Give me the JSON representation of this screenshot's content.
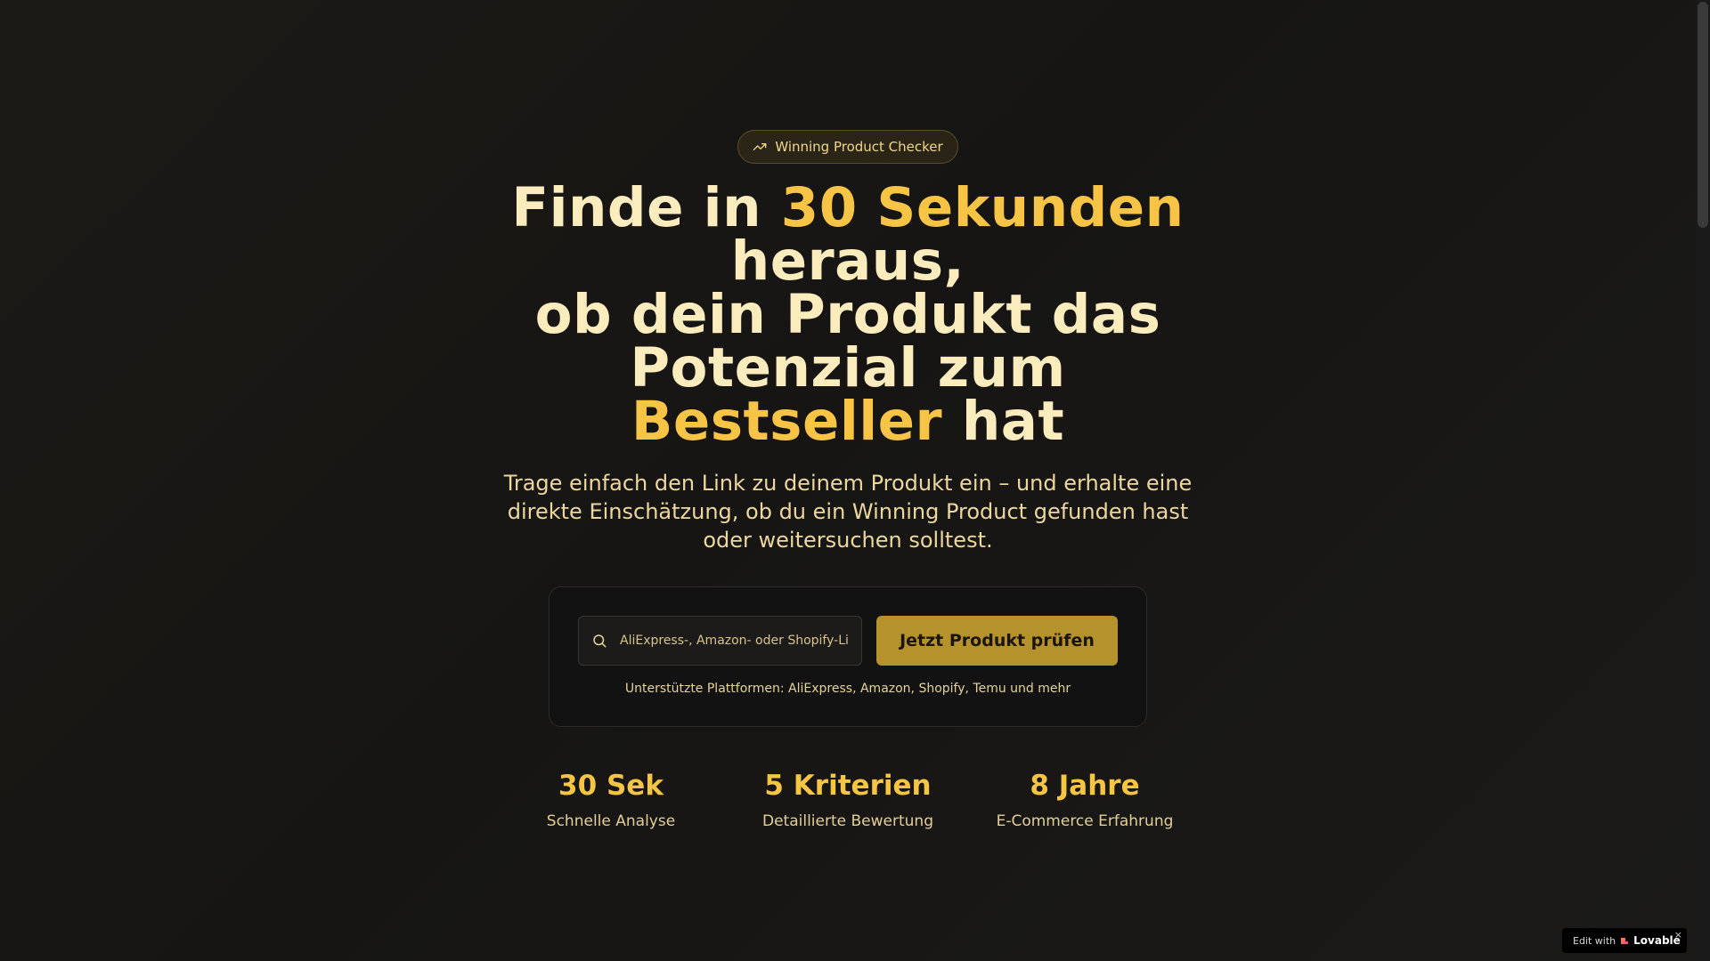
{
  "badge": {
    "icon": "trending-up-icon",
    "label": "Winning Product Checker"
  },
  "headline": {
    "part1": "Finde in ",
    "highlight1": "30 Sekunden",
    "part2": " heraus,",
    "part3": "ob dein Produkt das Potenzial zum ",
    "highlight2": "Bestseller",
    "part4": " hat"
  },
  "subtitle": "Trage einfach den Link zu deinem Produkt ein – und erhalte eine direkte Einschätzung, ob du ein Winning Product gefunden hast oder weitersuchen solltest.",
  "search": {
    "icon": "search-icon",
    "placeholder": "AliExpress-, Amazon- oder Shopify-Link einfügen",
    "value": ""
  },
  "cta_label": "Jetzt Produkt prüfen",
  "platforms_note": "Unterstützte Plattformen: AliExpress, Amazon, Shopify, Temu und mehr",
  "stats": [
    {
      "value": "30 Sek",
      "label": "Schnelle Analyse"
    },
    {
      "value": "5 Kriterien",
      "label": "Detaillierte Bewertung"
    },
    {
      "value": "8 Jahre",
      "label": "E-Commerce Erfahrung"
    }
  ],
  "lovable": {
    "prefix": "Edit with",
    "brand": "Lovable",
    "close": "×"
  },
  "colors": {
    "accent": "#f7c445",
    "button": "#b5922c",
    "background": "#161513"
  }
}
